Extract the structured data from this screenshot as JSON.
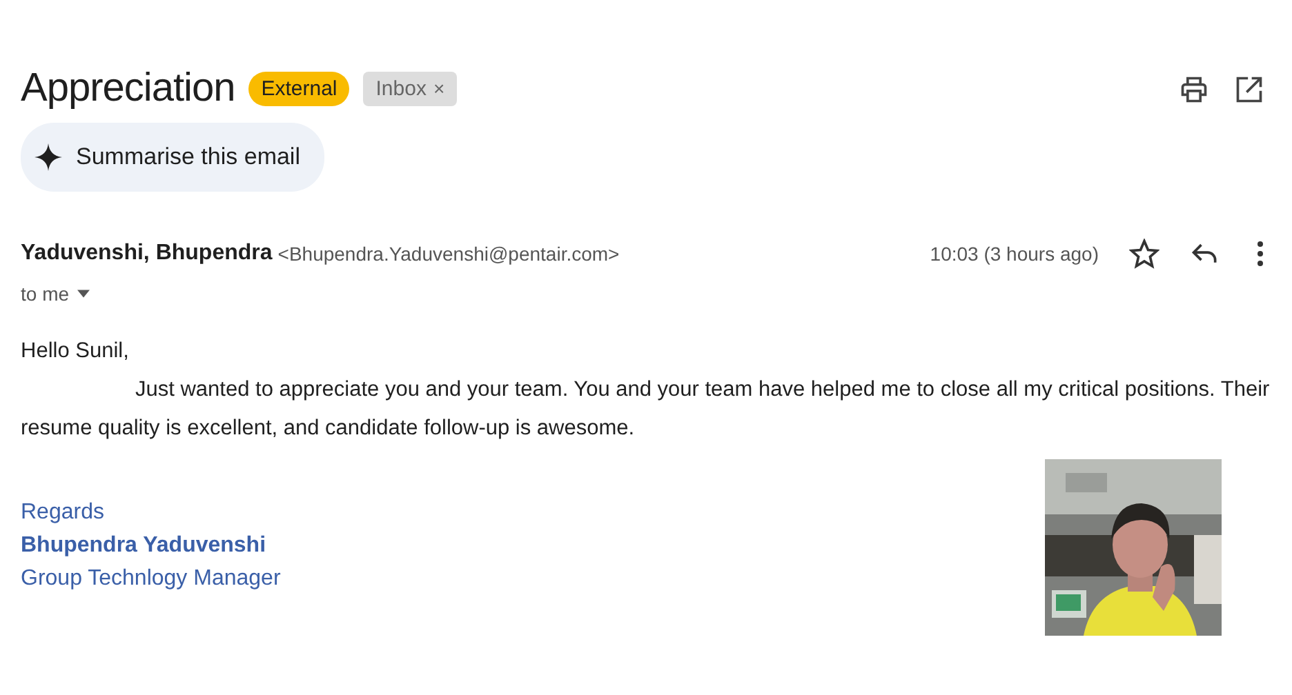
{
  "subject": "Appreciation",
  "labels": [
    {
      "text": "External",
      "kind": "external"
    },
    {
      "text": "Inbox",
      "kind": "removable",
      "remove": "×"
    }
  ],
  "summarise_button": "Summarise this email",
  "sender": {
    "name": "Yaduvenshi, Bhupendra",
    "email": "<Bhupendra.Yaduvenshi@pentair.com>",
    "recipient": "to me",
    "time": "10:03 (3 hours ago)",
    "starred": false
  },
  "body": {
    "greeting": "Hello Sunil,",
    "paragraph": "Just wanted to appreciate you and your team. You and your team have helped me to close all my critical positions. Their resume quality is excellent, and candidate follow-up is awesome."
  },
  "signature": {
    "closing": "Regards",
    "name": "Bhupendra Yaduvenshi",
    "title": "Group Technlogy Manager"
  }
}
